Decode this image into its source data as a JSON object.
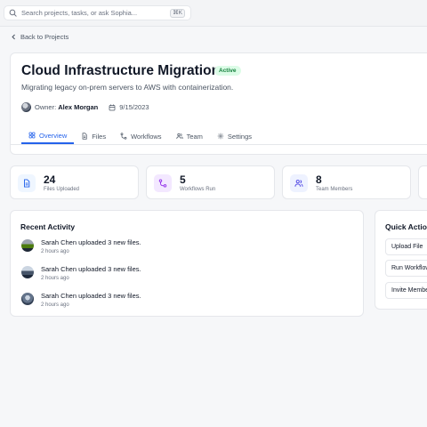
{
  "search": {
    "placeholder": "Search projects, tasks, or ask Sophia...",
    "shortcut": "⌘K"
  },
  "nav": {
    "back_label": "Back to Projects"
  },
  "project": {
    "title": "Cloud Infrastructure Migration",
    "status": "Active",
    "description": "Migrating legacy on-prem servers to AWS with containerization.",
    "owner_label": "Owner:",
    "owner_name": "Alex Morgan",
    "date": "9/15/2023"
  },
  "tabs": [
    {
      "label": "Overview",
      "icon": "grid-icon",
      "active": true
    },
    {
      "label": "Files",
      "icon": "file-icon",
      "active": false
    },
    {
      "label": "Workflows",
      "icon": "workflow-icon",
      "active": false
    },
    {
      "label": "Team",
      "icon": "users-icon",
      "active": false
    },
    {
      "label": "Settings",
      "icon": "gear-icon",
      "active": false
    }
  ],
  "stats": [
    {
      "value": "24",
      "label": "Files Uploaded",
      "icon": "file-icon",
      "color": "#2563eb"
    },
    {
      "value": "5",
      "label": "Workflows Run",
      "icon": "workflow-icon",
      "color": "#9333ea"
    },
    {
      "value": "8",
      "label": "Team Members",
      "icon": "users-icon",
      "color": "#4f46e5"
    }
  ],
  "activity": {
    "title": "Recent Activity",
    "items": [
      {
        "user": "Sarah Chen",
        "action": "uploaded 3 new files.",
        "time": "2 hours ago"
      },
      {
        "user": "Sarah Chen",
        "action": "uploaded 3 new files.",
        "time": "2 hours ago"
      },
      {
        "user": "Sarah Chen",
        "action": "uploaded 3 new files.",
        "time": "2 hours ago"
      }
    ]
  },
  "quick_actions": {
    "title": "Quick Actions",
    "buttons": [
      "Upload File",
      "Run Workflow",
      "Invite Member"
    ]
  },
  "colors": {
    "accent": "#2563eb",
    "status_bg": "#dcfce7",
    "status_text": "#15803d"
  }
}
